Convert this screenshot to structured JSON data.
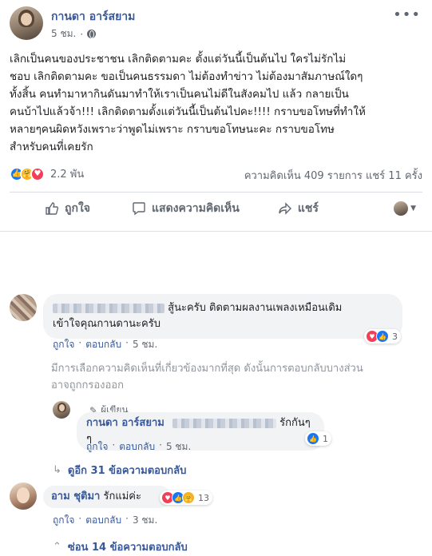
{
  "post": {
    "author": "กานดา อาร์สยาม",
    "time": "5 ชม.",
    "privacy_icon": "globe-icon",
    "body_lines": [
      "เลิกเป็นคนของประชาชน เลิกติดตามคะ ตั้งแต่วันนี้เป็นต้นไป ใครไม่รักไม่",
      "ชอบ เลิกติดตามคะ ขอเป็นคนธรรมดา ไม่ต้องทำข่าว ไม่ต้องมาสัมภาษณ์ใดๆ",
      "ทั้งสิ้น คนทำมาหากินดันมาทำให้เราเป็นคนไม่ดีในสังคมไป แล้ว กลายเป็น",
      "คนบ้าไปแล้วจ้า!!! เลิกติดตามตั้งแต่วันนี้เป็นต้นไปคะ!!!! กราบขอโทษที่ทำให้",
      "หลายๆคนผิดหวังเพราะว่าพูดไม่เพราะ กราบขอโทษนะคะ กราบขอโทษ",
      "สำหรับคนที่เคยรัก"
    ],
    "reaction_count": "2.2 พัน",
    "stats": "ความคิดเห็น 409 รายการ  แชร์ 11 ครั้ง",
    "actions": {
      "like": "ถูกใจ",
      "comment": "แสดงความคิดเห็น",
      "share": "แชร์"
    }
  },
  "comments": [
    {
      "text_line1": "สู้นะครับ ติดตามผลงานเพลงเหมือนเดิม",
      "text_line2": "เข้าใจคุณกานดานะครับ",
      "like": "ถูกใจ",
      "reply": "ตอบกลับ",
      "time": "5 ชม.",
      "reactions": "3"
    }
  ],
  "notice": {
    "line1": "มีการเลือกความคิดเห็นที่เกี่ยวข้องมากที่สุด ดังนั้นการตอบกลับบางส่วน",
    "line2": "อาจถูกกรองออก"
  },
  "reply": {
    "badge": "ผู้เขียน",
    "author": "กานดา อาร์สยาม",
    "text": "รักกันๆๆ",
    "like": "ถูกใจ",
    "reply": "ตอบกลับ",
    "time": "5 ชม.",
    "reactions": "1"
  },
  "more_replies_1": "ดูอีก 31 ข้อความตอบกลับ",
  "comment2": {
    "author": "อาม ชุติมา",
    "text": "รักแม่ค่ะ",
    "like": "ถูกใจ",
    "reply": "ตอบกลับ",
    "time": "3 ชม.",
    "reactions": "13"
  },
  "more_replies_2": "ซ่อน 14 ข้อความตอบกลับ",
  "colors": {
    "link": "#385898",
    "like_blue": "#1877f2",
    "love_red": "#f33e58",
    "care_yellow": "#f7b125"
  }
}
